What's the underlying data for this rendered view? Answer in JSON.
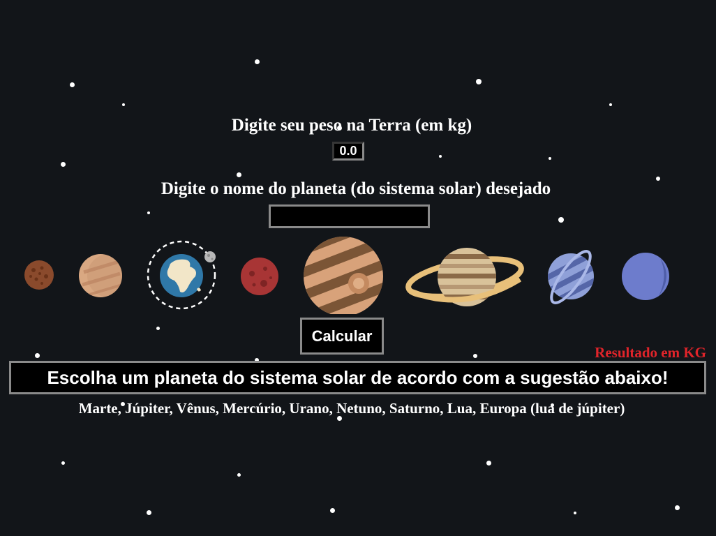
{
  "form": {
    "weight_label": "Digite seu peso na Terra (em kg)",
    "weight_value": "0.0",
    "planet_label": "Digite o nome do planeta (do sistema solar) desejado",
    "planet_value": "",
    "calculate_label": "Calcular"
  },
  "result": {
    "unit_label": "Resultado em KG",
    "message": "Escolha um planeta do sistema solar de acordo com a sugestão abaixo!",
    "suggestion": "Marte, Júpiter, Vênus, Mercúrio, Urano, Netuno, Saturno, Lua, Europa (lua de júpiter)"
  },
  "colors": {
    "background": "#121519",
    "result_label": "#e0242a",
    "field_border": "#8a8a8a"
  },
  "planets": [
    "mercury",
    "venus",
    "earth",
    "mars",
    "jupiter",
    "saturn",
    "uranus",
    "neptune"
  ]
}
